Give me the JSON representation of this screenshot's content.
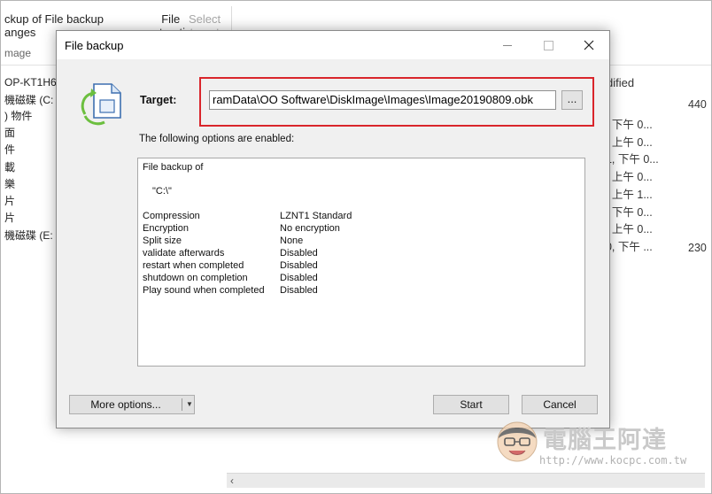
{
  "background": {
    "ribbon": {
      "backup_changes_label": "ckup of File backup\nanges",
      "file_restoration_label": "File\nrestoration",
      "select_target_label": "Select\ntarget",
      "image_label": "mage"
    },
    "nav_items": [
      "OP-KT1H6",
      "機磁碟 (C:",
      ") 物件",
      "面",
      "件",
      "載",
      "樂",
      "片",
      "片",
      "機磁碟 (E:"
    ],
    "column_header": "dified",
    "dates": [
      "8, 下午 0...",
      "9, 上午 0...",
      "31, 下午 0...",
      "9, 上午 0...",
      "4, 上午 1...",
      "8, 下午 0...",
      "9, 上午 0...",
      "30, 下午 ..."
    ],
    "sizes": [
      "440",
      "230"
    ]
  },
  "dialog": {
    "title": "File backup",
    "target_label": "Target:",
    "target_value": "ramData\\OO Software\\DiskImage\\Images\\Image20190809.obk",
    "browse_label": "...",
    "enabled_label": "The following options are enabled:",
    "options": {
      "header": "File backup of",
      "drive": "\"C:\\\"",
      "rows": [
        {
          "key": "Compression",
          "value": "LZNT1 Standard"
        },
        {
          "key": "Encryption",
          "value": "No encryption"
        },
        {
          "key": "Split size",
          "value": "None"
        },
        {
          "key": "validate afterwards",
          "value": "Disabled"
        },
        {
          "key": "restart when completed",
          "value": "Disabled"
        },
        {
          "key": "shutdown on completion",
          "value": "Disabled"
        },
        {
          "key": "Play sound when completed",
          "value": "Disabled"
        }
      ]
    },
    "more_options_label": "More options...",
    "start_label": "Start",
    "cancel_label": "Cancel",
    "highlight_color": "#d9252b"
  },
  "watermark": {
    "title": "電腦王阿達",
    "url": "http://www.kocpc.com.tw"
  }
}
